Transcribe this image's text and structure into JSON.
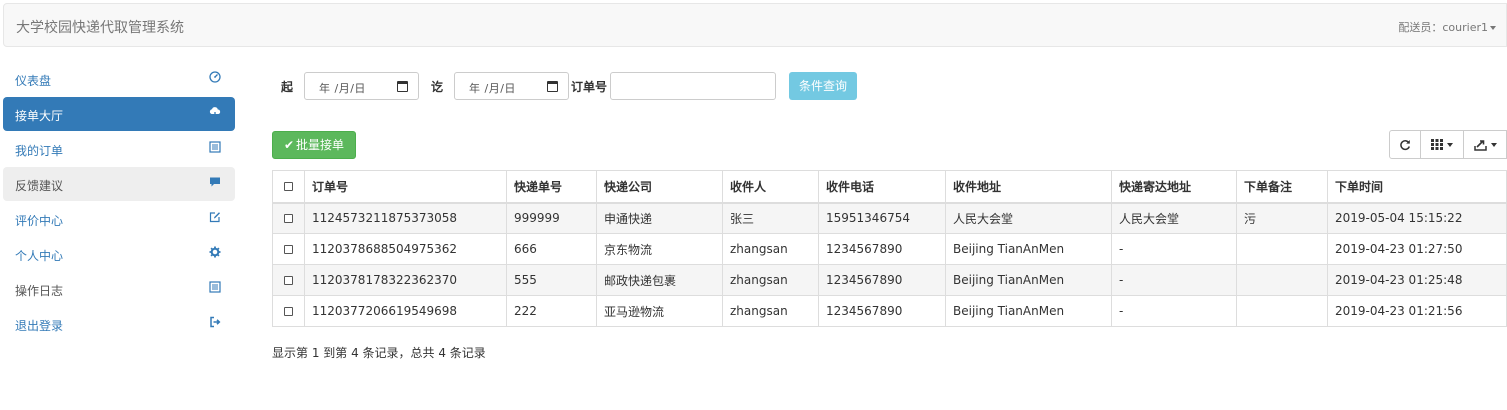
{
  "header": {
    "brand": "大学校园快递代取管理系统",
    "user_label": "配送员：courier1"
  },
  "sidebar": {
    "items": [
      {
        "label": "仪表盘",
        "icon": "dashboard-icon"
      },
      {
        "label": "接单大厅",
        "icon": "cloud-download-icon",
        "state": "active"
      },
      {
        "label": "我的订单",
        "icon": "list-alt-icon"
      },
      {
        "label": "反馈建议",
        "icon": "comment-icon",
        "state": "hover"
      },
      {
        "label": "评价中心",
        "icon": "edit-icon"
      },
      {
        "label": "个人中心",
        "icon": "cog-icon"
      },
      {
        "label": "操作日志",
        "icon": "list-alt-icon"
      },
      {
        "label": "退出登录",
        "icon": "log-out-icon"
      }
    ]
  },
  "filter": {
    "start_label": "起",
    "start_value": "年 /月/日",
    "end_label": "讫",
    "end_value": "年 /月/日",
    "order_label": "订单号",
    "order_value": "",
    "query_button": "条件查询"
  },
  "toolbar": {
    "batch_accept": "批量接单",
    "refresh_icon": "refresh-icon",
    "columns_icon": "th-icon",
    "export_icon": "export-icon"
  },
  "table": {
    "headers": [
      "订单号",
      "快递单号",
      "快递公司",
      "收件人",
      "收件电话",
      "收件地址",
      "快递寄达地址",
      "下单备注",
      "下单时间"
    ],
    "rows": [
      [
        "1124573211875373058",
        "999999",
        "申通快递",
        "张三",
        "15951346754",
        "人民大会堂",
        "人民大会堂",
        "污",
        "2019-05-04 15:15:22"
      ],
      [
        "1120378688504975362",
        "666",
        "京东物流",
        "zhangsan",
        "1234567890",
        "Beijing TianAnMen",
        "-",
        "",
        "2019-04-23 01:27:50"
      ],
      [
        "1120378178322362370",
        "555",
        "邮政快递包裹",
        "zhangsan",
        "1234567890",
        "Beijing TianAnMen",
        "-",
        "",
        "2019-04-23 01:25:48"
      ],
      [
        "1120377206619549698",
        "222",
        "亚马逊物流",
        "zhangsan",
        "1234567890",
        "Beijing TianAnMen",
        "-",
        "",
        "2019-04-23 01:21:56"
      ]
    ]
  },
  "pagination": {
    "info": "显示第 1 到第 4 条记录，总共 4 条记录"
  },
  "colors": {
    "primary": "#337ab7",
    "success": "#5cb85c",
    "info": "#5bc0de"
  }
}
